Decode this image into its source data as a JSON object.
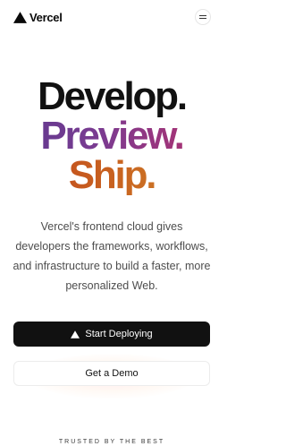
{
  "header": {
    "brand": "Vercel",
    "logo_icon": "vercel-triangle-icon",
    "menu_icon": "hamburger-menu-icon"
  },
  "hero": {
    "line1": "Develop.",
    "line2": "Preview.",
    "line3": "Ship."
  },
  "tagline": "Vercel's frontend cloud gives developers the frameworks, workflows, and infrastructure to build a faster, more personalized Web.",
  "cta": {
    "primary_label": "Start Deploying",
    "secondary_label": "Get a Demo"
  },
  "trusted_label": "TRUSTED BY THE BEST",
  "colors": {
    "text": "#111111",
    "preview_gradient": [
      "#5b3a8f",
      "#b8306a"
    ],
    "ship_gradient": [
      "#c2451e",
      "#d18a2c"
    ]
  }
}
